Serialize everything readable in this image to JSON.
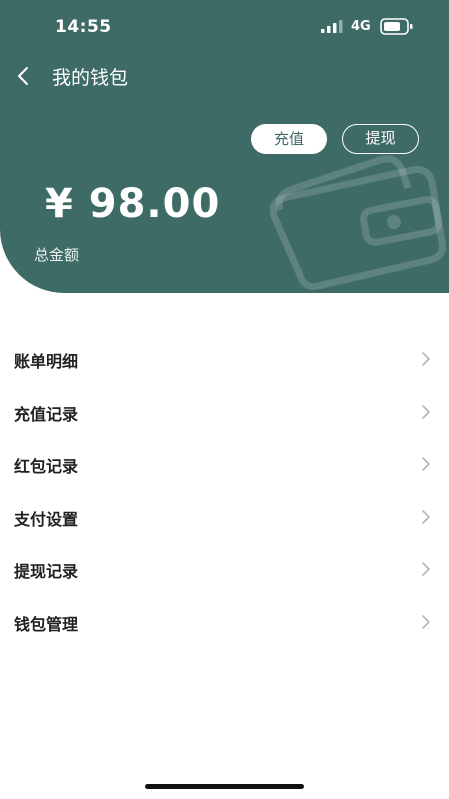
{
  "status_bar": {
    "time": "14:55",
    "network": "4G"
  },
  "nav": {
    "title": "我的钱包"
  },
  "actions": {
    "recharge_label": "充值",
    "withdraw_label": "提现"
  },
  "wallet": {
    "balance": "¥ 98.00",
    "balance_label": "总金额"
  },
  "menu": {
    "items": [
      {
        "label": "账单明细"
      },
      {
        "label": "充值记录"
      },
      {
        "label": "红包记录"
      },
      {
        "label": "支付设置"
      },
      {
        "label": "提现记录"
      },
      {
        "label": "钱包管理"
      }
    ]
  },
  "colors": {
    "header_bg": "#3f6b67",
    "text_dark": "#222222",
    "chevron": "#b5b5b5"
  }
}
